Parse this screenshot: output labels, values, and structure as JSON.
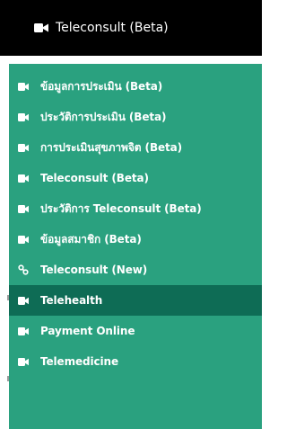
{
  "header": {
    "label": "Teleconsult (Beta)",
    "icon": "video-camera-icon"
  },
  "menu": {
    "items": [
      {
        "label": "ข้อมูลการประเมิน (Beta)",
        "icon": "video-camera-icon"
      },
      {
        "label": "ประวัติการประเมิน (Beta)",
        "icon": "video-camera-icon"
      },
      {
        "label": "การประเมินสุขภาพจิต (Beta)",
        "icon": "video-camera-icon"
      },
      {
        "label": "Teleconsult (Beta)",
        "icon": "video-camera-icon"
      },
      {
        "label": "ประวัติการ Teleconsult (Beta)",
        "icon": "video-camera-icon"
      },
      {
        "label": "ข้อมูลสมาชิก (Beta)",
        "icon": "video-camera-icon"
      },
      {
        "label": "Teleconsult (New)",
        "icon": "link-icon"
      },
      {
        "label": "Telehealth",
        "icon": "video-camera-icon",
        "active": true
      },
      {
        "label": "Payment Online",
        "icon": "video-camera-icon"
      },
      {
        "label": "Telemedicine",
        "icon": "video-camera-icon"
      }
    ]
  },
  "colors": {
    "header_bg": "#000000",
    "menu_bg": "#2aa17f",
    "active_bg": "#0e6c55",
    "text": "#ffffff"
  }
}
